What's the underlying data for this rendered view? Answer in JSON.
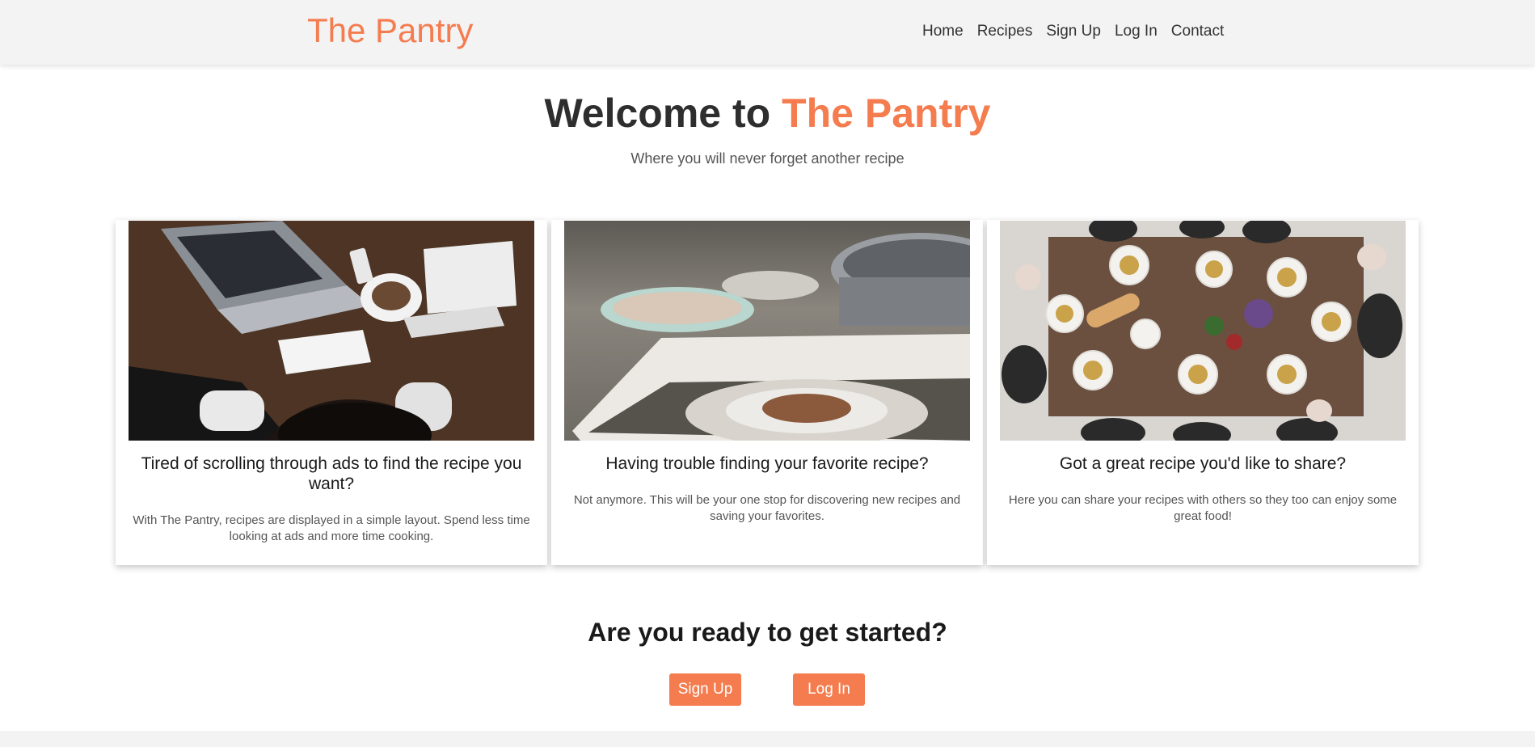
{
  "navbar": {
    "brand": "The Pantry",
    "links": [
      "Home",
      "Recipes",
      "Sign Up",
      "Log In",
      "Contact"
    ]
  },
  "hero": {
    "title_prefix": "Welcome to ",
    "title_accent": "The Pantry",
    "subtitle": "Where you will never forget another recipe"
  },
  "cards": [
    {
      "title": "Tired of scrolling through ads to find the recipe you want?",
      "text": "With The Pantry, recipes are displayed in a simple layout. Spend less time looking at ads and more time cooking."
    },
    {
      "title": "Having trouble finding your favorite recipe?",
      "text": "Not anymore. This will be your one stop for discovering new recipes and saving your favorites."
    },
    {
      "title": "Got a great recipe you'd like to share?",
      "text": "Here you can share your recipes with others so they too can enjoy some great food!"
    }
  ],
  "cta": {
    "title": "Are you ready to get started?",
    "signup_label": "Sign Up",
    "login_label": "Log In"
  },
  "colors": {
    "accent": "#f47c4f",
    "navbar_bg": "#f3f3f3"
  }
}
